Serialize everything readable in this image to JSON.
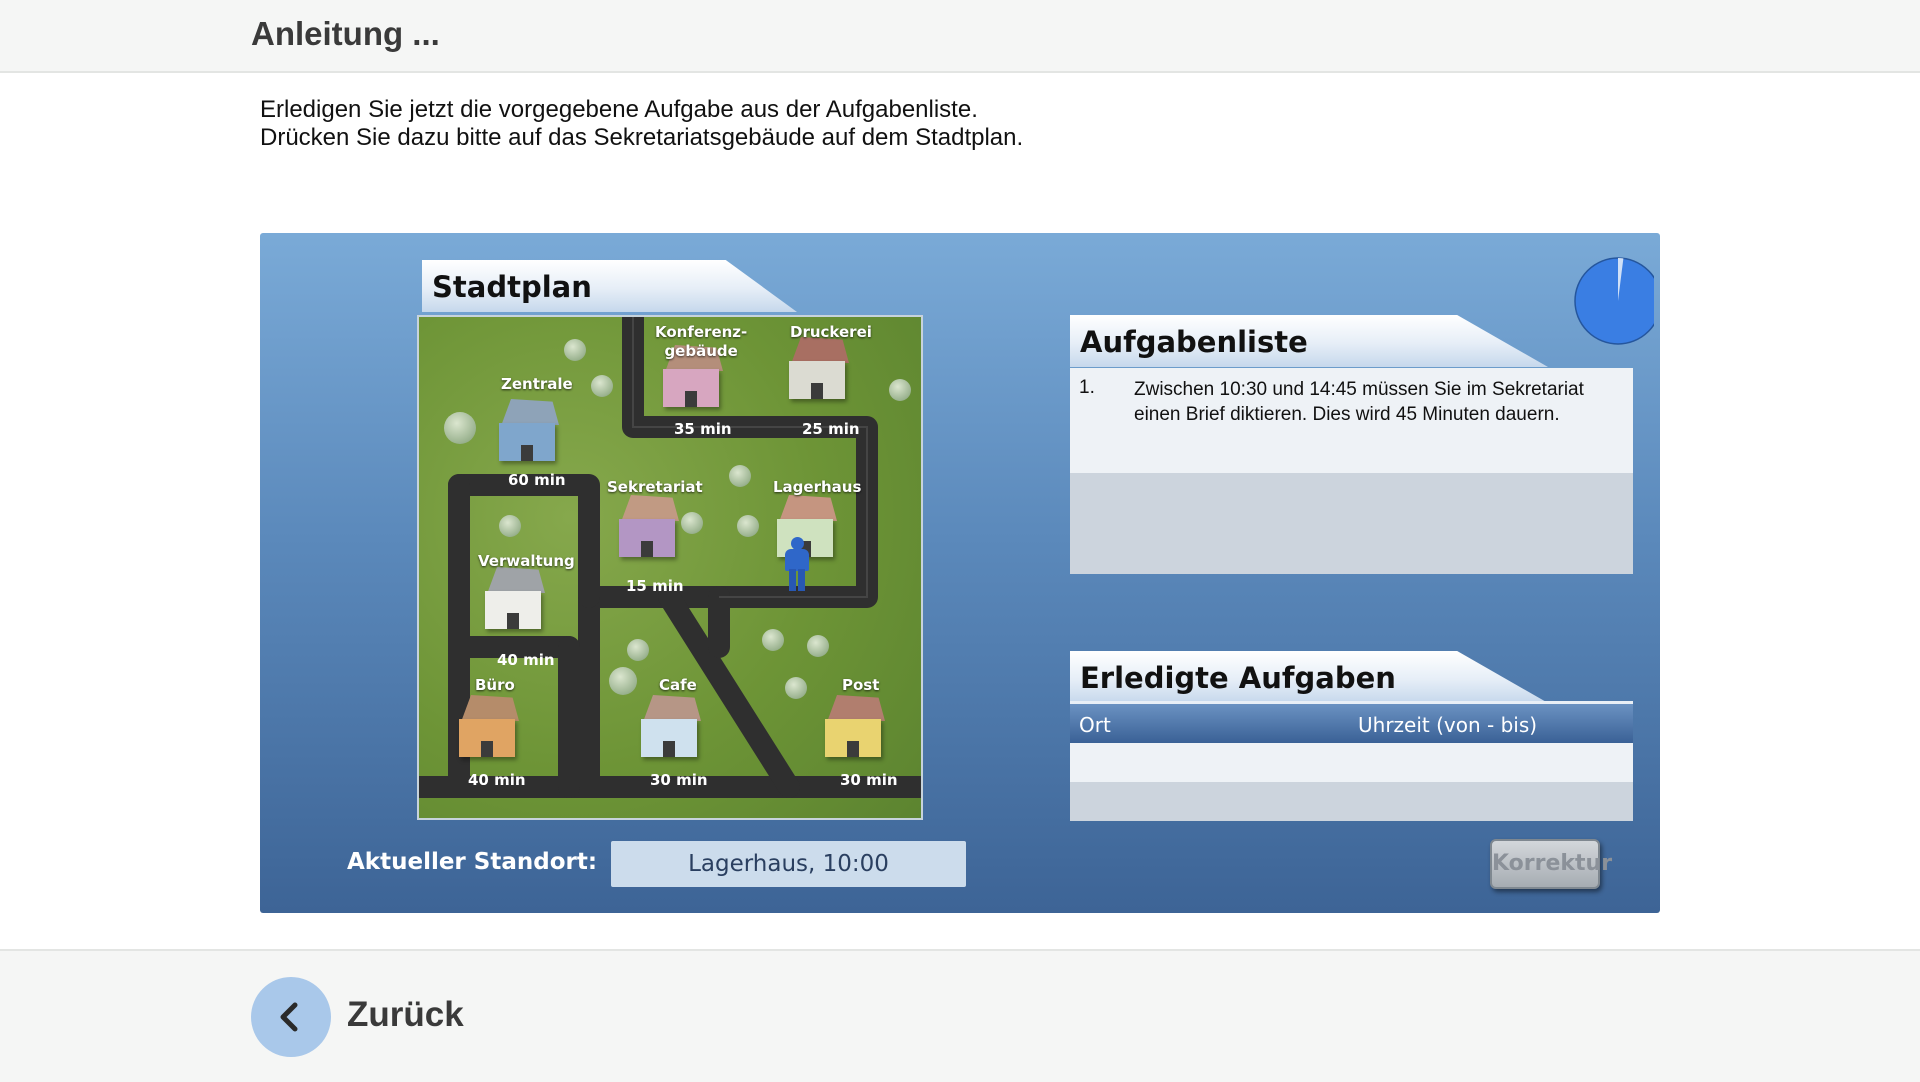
{
  "header": {
    "title": "Anleitung ..."
  },
  "instructions": {
    "line1": "Erledigen Sie jetzt die vorgegebene Aufgabe aus der Aufgabenliste.",
    "line2": "Drücken Sie dazu bitte auf das Sekretariatsgebäude auf dem Stadtplan."
  },
  "stadtplan": {
    "title": "Stadtplan",
    "buildings": [
      {
        "name": "Zentrale",
        "time": "60 min"
      },
      {
        "name": "Konferenz-\ngebäude",
        "time": "35 min"
      },
      {
        "name": "Druckerei",
        "time": "25 min"
      },
      {
        "name": "Sekretariat",
        "time": "15 min"
      },
      {
        "name": "Lagerhaus",
        "time": ""
      },
      {
        "name": "Verwaltung",
        "time": "40 min"
      },
      {
        "name": "Büro",
        "time": "40 min"
      },
      {
        "name": "Cafe",
        "time": "30 min"
      },
      {
        "name": "Post",
        "time": "30 min"
      }
    ]
  },
  "aufgabenliste": {
    "title": "Aufgabenliste",
    "items": [
      {
        "number": "1.",
        "text": "Zwischen 10:30 und 14:45 müssen Sie im Sekretariat einen Brief diktieren. Dies wird 45 Minuten dauern."
      }
    ]
  },
  "erledigte": {
    "title": "Erledigte Aufgaben",
    "columns": [
      "Ort",
      "Uhrzeit (von - bis)"
    ],
    "rows": []
  },
  "clock": {
    "elapsed_fraction": 0.02,
    "color": "#3a7ee3"
  },
  "standort": {
    "label": "Aktueller Standort:",
    "value": "Lagerhaus, 10:00"
  },
  "korrektur": {
    "label": "Korrektur"
  },
  "footer": {
    "back_label": "Zurück",
    "back_icon": "chevron-left-icon"
  },
  "colors": {
    "accent": "#3a7ee3",
    "panel": "#5b89bb"
  }
}
